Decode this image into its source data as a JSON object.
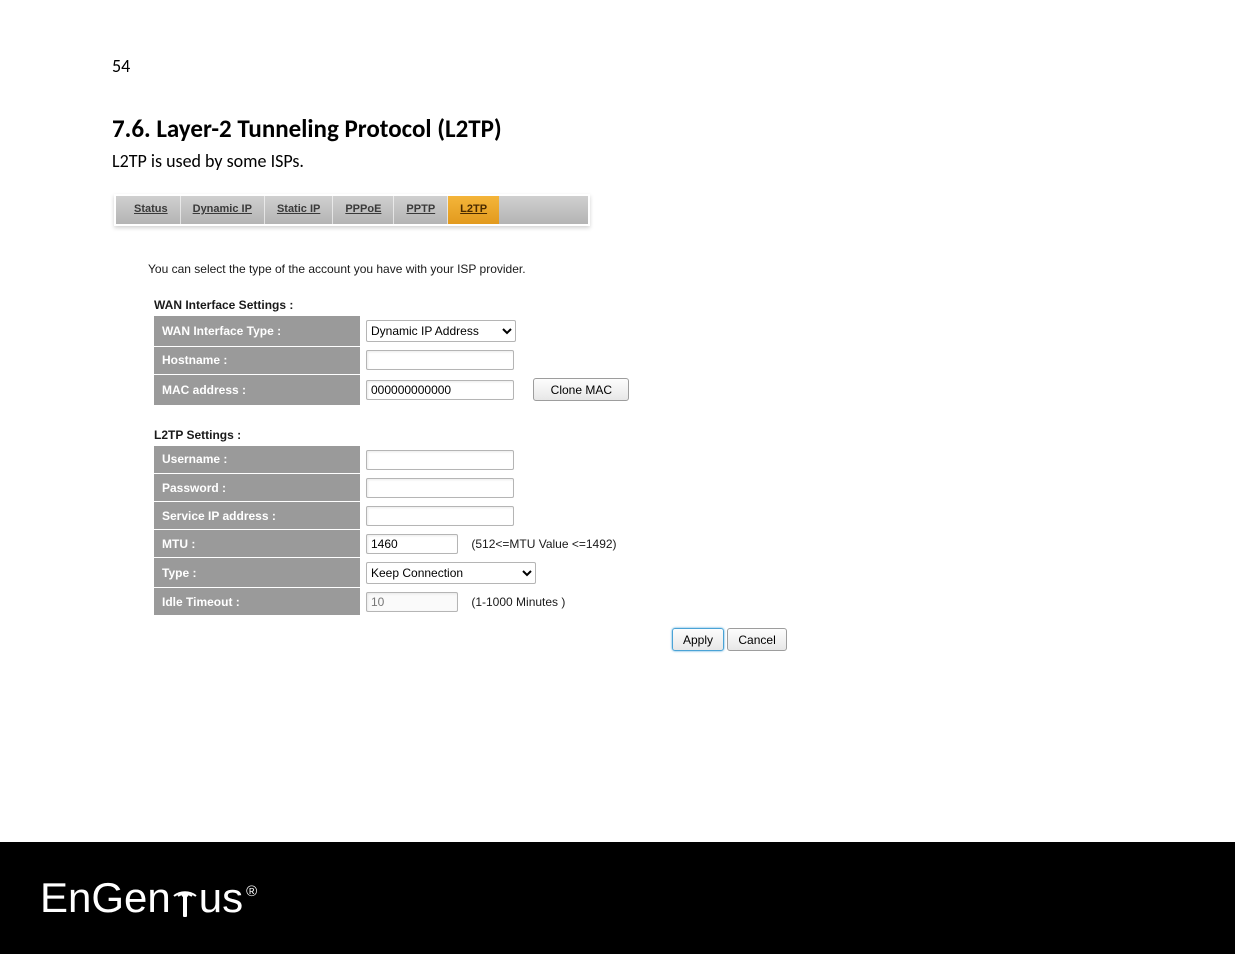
{
  "page": {
    "number": "54",
    "heading": "7.6. Layer-2 Tunneling Protocol (L2TP)",
    "intro": "L2TP is used by some ISPs."
  },
  "tabs": [
    "Status",
    "Dynamic IP",
    "Static IP",
    "PPPoE",
    "PPTP",
    "L2TP"
  ],
  "active_tab": "L2TP",
  "hint": "You can select the type of the account you have with your ISP provider.",
  "wan": {
    "title": "WAN Interface Settings :",
    "labels": {
      "iface_type": "WAN Interface Type :",
      "hostname": "Hostname :",
      "mac": "MAC address :"
    },
    "iface_type_value": "Dynamic IP Address",
    "hostname_value": "",
    "mac_value": "000000000000",
    "clone_label": "Clone MAC"
  },
  "l2tp": {
    "title": "L2TP Settings :",
    "labels": {
      "username": "Username :",
      "password": "Password :",
      "service_ip": "Service IP address :",
      "mtu": "MTU :",
      "type": "Type :",
      "idle": "Idle Timeout :"
    },
    "username_value": "",
    "password_value": "",
    "service_ip_value": "",
    "mtu_value": "1460",
    "mtu_note": "(512<=MTU Value <=1492)",
    "type_value": "Keep Connection",
    "idle_value": "10",
    "idle_note": "(1-1000 Minutes )"
  },
  "actions": {
    "apply": "Apply",
    "cancel": "Cancel"
  },
  "footer": {
    "brand": "EnGenius"
  }
}
